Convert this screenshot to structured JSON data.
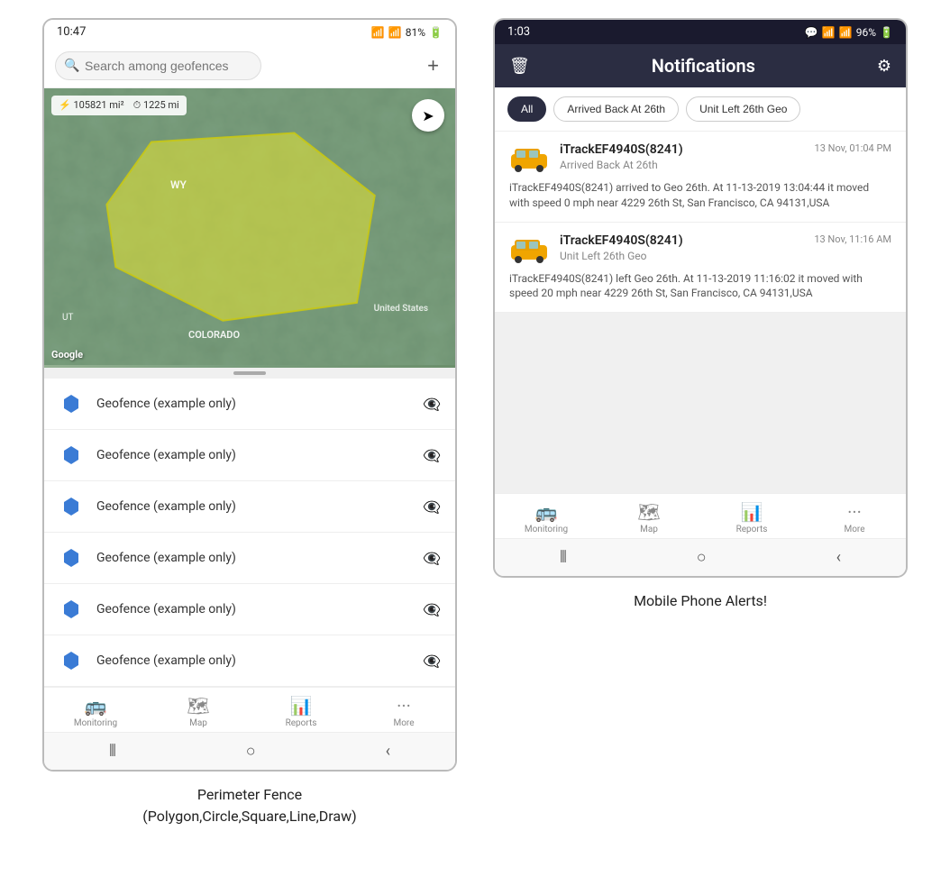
{
  "left_phone": {
    "status_bar": {
      "time": "10:47",
      "signal": "WiFi",
      "battery": "81%"
    },
    "search": {
      "placeholder": "Search among geofences"
    },
    "map": {
      "area_label": "105821 mi²",
      "distance_label": "1225 mi",
      "label_wy": "WY",
      "label_us": "United States",
      "label_co": "COLORADO",
      "label_ut": "UT",
      "google": "Google"
    },
    "geofence_items": [
      {
        "label": "Geofence (example only)"
      },
      {
        "label": "Geofence (example only)"
      },
      {
        "label": "Geofence (example only)"
      },
      {
        "label": "Geofence (example only)"
      },
      {
        "label": "Geofence (example only)"
      },
      {
        "label": "Geofence (example only)"
      }
    ],
    "nav": {
      "items": [
        {
          "label": "Monitoring"
        },
        {
          "label": "Map"
        },
        {
          "label": "Reports"
        },
        {
          "label": "More"
        }
      ]
    },
    "caption": "Perimeter Fence\n(Polygon,Circle,Square,Line,Draw)"
  },
  "right_phone": {
    "status_bar": {
      "time": "1:03",
      "battery": "96%"
    },
    "header": {
      "title": "Notifications",
      "trash_icon": "trash",
      "settings_icon": "settings"
    },
    "filter_tabs": [
      {
        "label": "All",
        "active": true
      },
      {
        "label": "Arrived Back At 26th",
        "active": false
      },
      {
        "label": "Unit Left 26th Geo",
        "active": false
      }
    ],
    "notifications": [
      {
        "device": "iTrackEF4940S(8241)",
        "time": "13 Nov, 01:04 PM",
        "subtitle": "Arrived Back At 26th",
        "body": "iTrackEF4940S(8241) arrived to Geo 26th.   At 11-13-2019 13:04:44 it moved with speed 0 mph near 4229 26th St, San Francisco, CA 94131,USA"
      },
      {
        "device": "iTrackEF4940S(8241)",
        "time": "13 Nov, 11:16 AM",
        "subtitle": "Unit Left 26th Geo",
        "body": "iTrackEF4940S(8241) left Geo 26th.   At 11-13-2019 11:16:02 it moved with speed 20 mph near 4229 26th St, San Francisco, CA 94131,USA"
      }
    ],
    "nav": {
      "items": [
        {
          "label": "Monitoring"
        },
        {
          "label": "Map"
        },
        {
          "label": "Reports"
        },
        {
          "label": "More"
        }
      ]
    },
    "caption": "Mobile Phone Alerts!"
  }
}
